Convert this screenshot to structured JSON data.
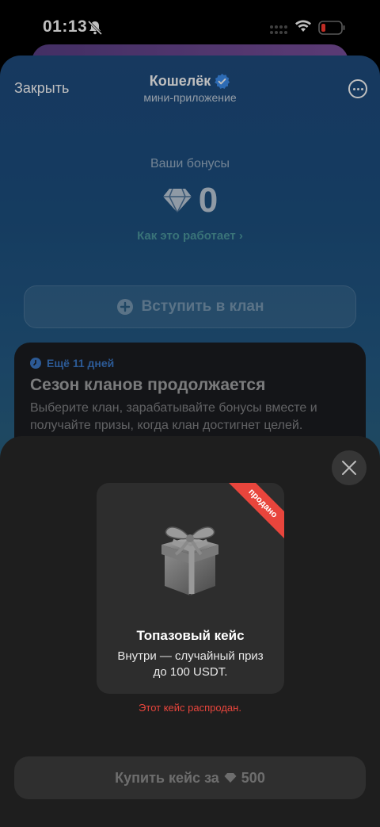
{
  "status_bar": {
    "time": "01:13"
  },
  "header": {
    "close_label": "Закрыть",
    "title": "Кошелёк",
    "subtitle": "мини-приложение"
  },
  "bonus": {
    "label": "Ваши бонусы",
    "value": "0",
    "how_link": "Как это работает ›"
  },
  "join_button": {
    "label": "Вступить в клан"
  },
  "season_card": {
    "meta": "Ещё 11 дней",
    "title": "Сезон кланов продолжается",
    "description": "Выберите клан, зарабатывайте бонусы вместе и получайте призы, когда клан достигнет целей."
  },
  "modal": {
    "ribbon": "продано",
    "case_title": "Топазовый кейс",
    "case_description": "Внутри — случайный приз до 100 USDT.",
    "soldout_note": "Этот кейс распродан.",
    "buy_label": "Купить кейс за",
    "buy_price": "500"
  },
  "colors": {
    "accent_blue": "#3b79c8",
    "link_teal": "#4d9aa0",
    "sold_red": "#e8453c"
  }
}
